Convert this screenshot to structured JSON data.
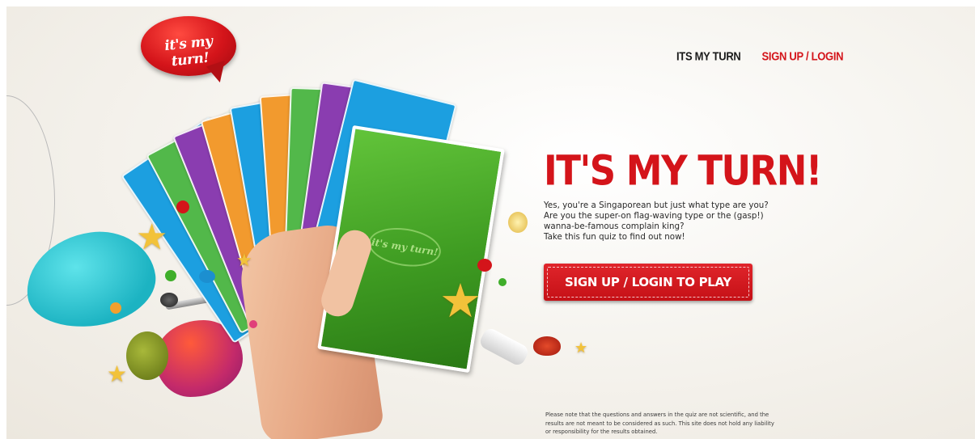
{
  "logo": {
    "text": "it's my turn!"
  },
  "nav": {
    "its_my_turn": "ITS MY TURN",
    "signup_login": "SIGN UP  /  LOGIN"
  },
  "hero": {
    "title": "IT'S MY TURN!",
    "desc_lines": [
      "Yes, you're a Singaporean but just what type are you?",
      "Are you the super-on flag-waving type or the (gasp!)",
      "wanna-be-famous complain king?",
      "Take this fun quiz to find out now!"
    ],
    "cta": "SIGN UP / LOGIN TO PLAY"
  },
  "card_logo": "it's my turn!",
  "disclaimer": {
    "lines": [
      "Please note that the questions and answers in the quiz are not scientific, and the",
      "results are not meant to be considered as such. This site does not hold any liability",
      "or responsibility for the results obtained."
    ]
  },
  "colors": {
    "brand_red": "#d4141a",
    "card_green": "#3f9c22",
    "cyan": "#1cb3c2"
  },
  "icons": [
    "star-icon",
    "microphone-icon",
    "mahjong-tile-icon",
    "crab-icon",
    "durian-icon"
  ]
}
